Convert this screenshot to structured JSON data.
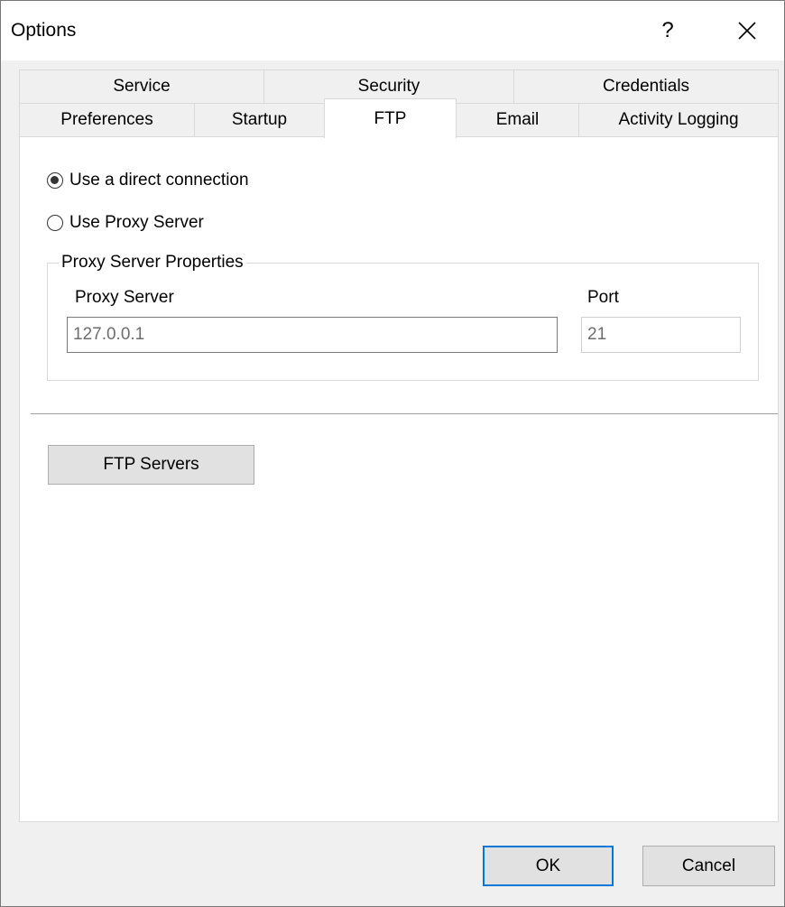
{
  "window": {
    "title": "Options",
    "help_label": "?",
    "close_icon": "close-icon"
  },
  "tabs": {
    "row_back": [
      {
        "label": "Service"
      },
      {
        "label": "Security"
      },
      {
        "label": "Credentials"
      }
    ],
    "row_front": [
      {
        "label": "Preferences"
      },
      {
        "label": "Startup"
      },
      {
        "label": "FTP",
        "selected": true
      },
      {
        "label": "Email"
      },
      {
        "label": "Activity Logging"
      }
    ]
  },
  "ftp": {
    "connection_options": [
      {
        "label": "Use a direct connection",
        "checked": true
      },
      {
        "label": "Use Proxy Server",
        "checked": false
      }
    ],
    "proxy_group": {
      "legend": "Proxy Server Properties",
      "server_label": "Proxy Server",
      "server_value": "127.0.0.1",
      "port_label": "Port",
      "port_value": "21"
    },
    "ftp_servers_button": "FTP Servers"
  },
  "footer": {
    "ok_label": "OK",
    "cancel_label": "Cancel"
  },
  "colors": {
    "accent": "#0078d7",
    "panel_bg": "#ffffff",
    "window_bg": "#f0f0f0"
  }
}
